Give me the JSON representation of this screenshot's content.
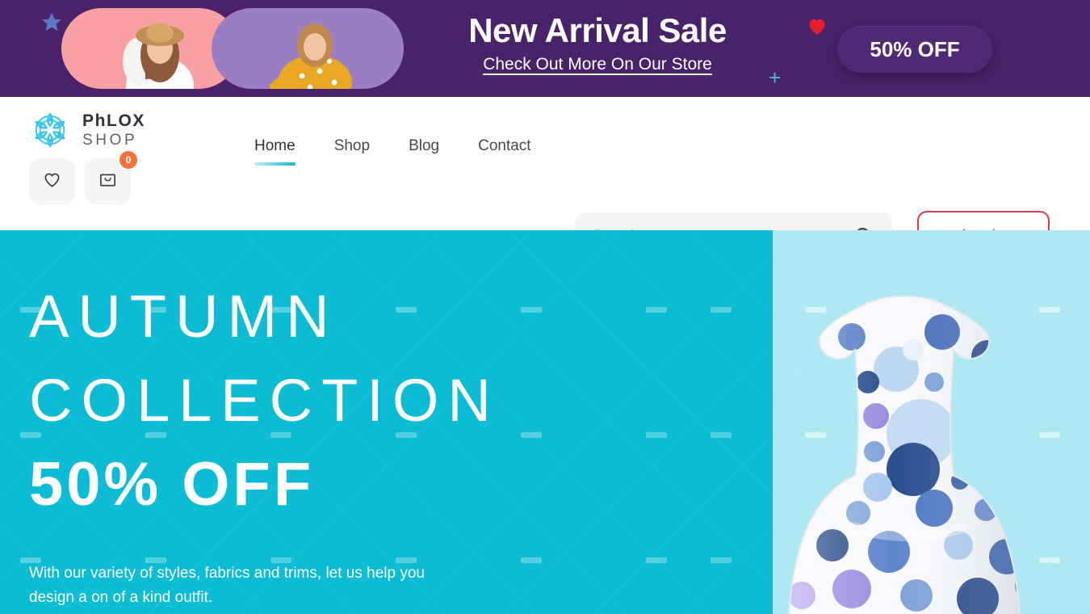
{
  "promo_banner": {
    "title": "New Arrival Sale",
    "link_label": "Check Out More On Our Store",
    "badge_label": "50% OFF",
    "decorations": {
      "star": "star-icon",
      "heart": "heart-icon",
      "plus": "plus-icon"
    },
    "colors": {
      "background": "#4a2269",
      "badge": "#512874",
      "star": "#5f79c8",
      "heart": "#ec1d2b",
      "plus": "#45bcc8",
      "model_pill_left": "#f9a0a5",
      "model_pill_right": "#9b7ec4"
    }
  },
  "header": {
    "logo": {
      "mark": "flower-mandala-icon",
      "name_top": "PhLOX",
      "name_bottom": "SHOP"
    },
    "icon_buttons": [
      {
        "name": "wishlist",
        "icon": "heart-icon",
        "badge": null
      },
      {
        "name": "cart",
        "icon": "shopping-bag-icon",
        "badge": "0"
      }
    ],
    "nav": [
      {
        "label": "Home",
        "active": true
      },
      {
        "label": "Shop",
        "active": false
      },
      {
        "label": "Blog",
        "active": false
      },
      {
        "label": "Contact",
        "active": false
      }
    ],
    "search": {
      "placeholder": "Search...",
      "value": "",
      "icon": "search-icon"
    },
    "login_label": "Log In",
    "colors": {
      "login_border": "#d93a50",
      "cart_badge": "#f2713c",
      "logo_mark": "#2ec4ef",
      "nav_active_underline": "#17b8d8"
    }
  },
  "hero": {
    "line1": "AUTUMN",
    "line2": "COLLECTION",
    "line3": "50% OFF",
    "subtitle": "With our variety of styles, fabrics and trims, let us help you design a on of a kind outfit.",
    "product_image": "polka-dot-dress-on-mannequin",
    "colors": {
      "left_panel": "#0bbcd4",
      "right_panel": "#aee8f2",
      "text": "#ffffff"
    }
  }
}
